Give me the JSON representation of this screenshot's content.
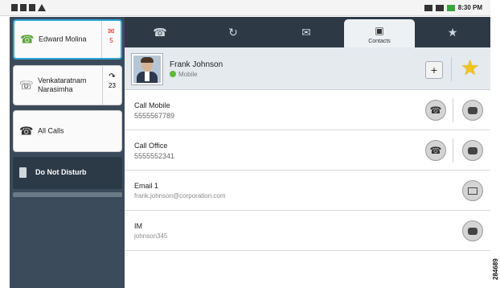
{
  "status_bar": {
    "left_icons": [
      "usb-icon",
      "usb-icon",
      "debug-icon",
      "warning-icon"
    ],
    "right_icons": [
      "network-icon",
      "signal-icon",
      "battery-icon"
    ],
    "time": "8:30 PM"
  },
  "lines": [
    {
      "label": "Edward Molina",
      "icon": "phone-ringing-icon",
      "side_icon": "voicemail-icon",
      "side_count": "5",
      "active": true
    },
    {
      "label": "Venkataratnam Narasimha",
      "icon": "handset-icon",
      "side_icon": "call-history-icon",
      "side_count": "23",
      "active": false
    },
    {
      "label": "All Calls",
      "icon": "all-calls-icon",
      "active": false
    }
  ],
  "do_not_disturb": {
    "label": "Do Not Disturb",
    "icon": "dnd-icon"
  },
  "tabs": [
    {
      "icon": "phone-icon",
      "label": ""
    },
    {
      "icon": "history-icon",
      "label": ""
    },
    {
      "icon": "voicemail-icon",
      "label": ""
    },
    {
      "icon": "contacts-icon",
      "label": "Contacts",
      "active": true
    },
    {
      "icon": "favorites-star-icon",
      "label": ""
    }
  ],
  "contact": {
    "name": "Frank Johnson",
    "status": "Mobile",
    "add_label": "+",
    "favorite": true
  },
  "rows": [
    {
      "label": "Call Mobile",
      "value": "5555567789",
      "actions": [
        "call",
        "message"
      ]
    },
    {
      "label": "Call Office",
      "value": "5555552341",
      "actions": [
        "call",
        "message"
      ]
    },
    {
      "label": "Email 1",
      "value": "frank.johnson@corporation.com",
      "actions": [
        "email"
      ]
    },
    {
      "label": "IM",
      "value": "johnson345",
      "actions": [
        "message"
      ]
    }
  ],
  "figure_code": "284689",
  "colors": {
    "rail": "#3b4b5c",
    "tabbar": "#2d3a46",
    "active_border": "#2fa6d8",
    "presence": "#5dba3b",
    "star": "#f0c419"
  }
}
